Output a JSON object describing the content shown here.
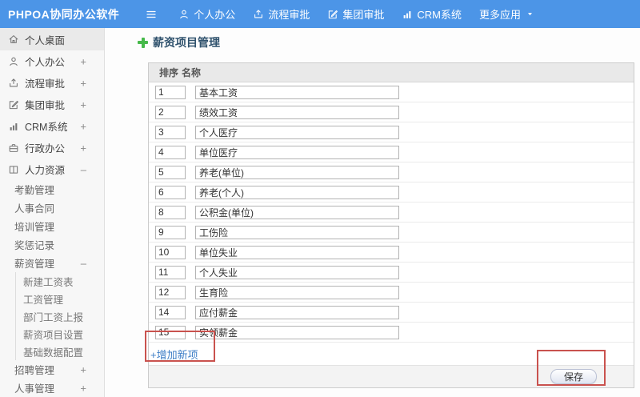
{
  "topbar": {
    "logo": "PHPOA协同办公软件",
    "nav": [
      {
        "key": "personal-office",
        "label": "个人办公",
        "icon": "user-icon"
      },
      {
        "key": "process-approval",
        "label": "流程审批",
        "icon": "process-icon"
      },
      {
        "key": "group-approval",
        "label": "集团审批",
        "icon": "approval-icon"
      },
      {
        "key": "crm-system",
        "label": "CRM系统",
        "icon": "chart-icon"
      },
      {
        "key": "more-apps",
        "label": "更多应用",
        "icon": null,
        "caret": true
      }
    ]
  },
  "sidebar": {
    "items": [
      {
        "key": "personal-desktop",
        "label": "个人桌面",
        "icon": "home-icon",
        "active": true
      },
      {
        "key": "personal-office",
        "label": "个人办公",
        "icon": "user-icon",
        "expand": "+"
      },
      {
        "key": "process-approval",
        "label": "流程审批",
        "icon": "process-icon",
        "expand": "+"
      },
      {
        "key": "group-approval",
        "label": "集团审批",
        "icon": "approval-icon",
        "expand": "+"
      },
      {
        "key": "crm-system",
        "label": "CRM系统",
        "icon": "chart-icon",
        "expand": "+"
      },
      {
        "key": "admin-office",
        "label": "行政办公",
        "icon": "briefcase-icon",
        "expand": "+"
      },
      {
        "key": "human-resources",
        "label": "人力资源",
        "icon": "hr-icon",
        "expand": "–",
        "children": [
          {
            "key": "attendance-management",
            "label": "考勤管理"
          },
          {
            "key": "hr-contract",
            "label": "人事合同"
          },
          {
            "key": "training-management",
            "label": "培训管理"
          },
          {
            "key": "reward-records",
            "label": "奖惩记录"
          },
          {
            "key": "salary-management",
            "label": "薪资管理",
            "expand": "–",
            "children": [
              {
                "key": "new-payroll-sheet",
                "label": "新建工资表"
              },
              {
                "key": "payroll-management",
                "label": "工资管理"
              },
              {
                "key": "department-payroll-report",
                "label": "部门工资上报"
              },
              {
                "key": "salary-item-settings",
                "label": "薪资项目设置"
              },
              {
                "key": "basic-data-config",
                "label": "基础数据配置"
              }
            ]
          },
          {
            "key": "recruitment-management",
            "label": "招聘管理",
            "expand": "+"
          },
          {
            "key": "personnel-management",
            "label": "人事管理",
            "expand": "+"
          }
        ]
      }
    ]
  },
  "main": {
    "title": "薪资项目管理",
    "table": {
      "headers": [
        "排序",
        "名称"
      ],
      "rows": [
        {
          "order": "1",
          "name": "基本工资"
        },
        {
          "order": "2",
          "name": "绩效工资"
        },
        {
          "order": "3",
          "name": "个人医疗"
        },
        {
          "order": "4",
          "name": "单位医疗"
        },
        {
          "order": "5",
          "name": "养老(单位)"
        },
        {
          "order": "6",
          "name": "养老(个人)"
        },
        {
          "order": "8",
          "name": "公积金(单位)"
        },
        {
          "order": "9",
          "name": "工伤险"
        },
        {
          "order": "10",
          "name": "单位失业"
        },
        {
          "order": "11",
          "name": "个人失业"
        },
        {
          "order": "12",
          "name": "生育险"
        },
        {
          "order": "14",
          "name": "应付薪金"
        },
        {
          "order": "15",
          "name": "实领薪金"
        }
      ]
    },
    "add_link": "+增加新项",
    "save_label": "保存"
  },
  "colors": {
    "topbar_blue": "#4c95e7",
    "plus_green": "#46b94a",
    "link_blue": "#3d7ec6",
    "title_navy": "#31536e",
    "annotation_red": "#c9524e",
    "table_header_gray": "#e9e9e9"
  }
}
